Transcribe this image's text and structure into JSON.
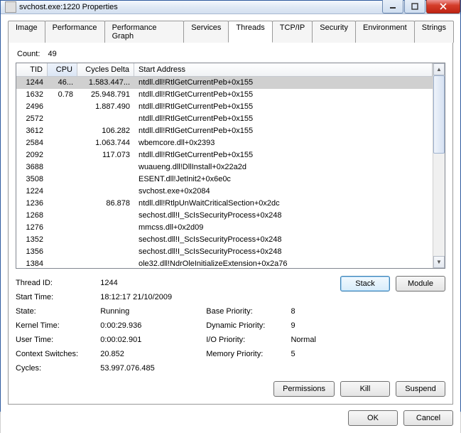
{
  "window": {
    "title": "svchost.exe:1220 Properties"
  },
  "tabs": [
    {
      "label": "Image"
    },
    {
      "label": "Performance"
    },
    {
      "label": "Performance Graph"
    },
    {
      "label": "Services"
    },
    {
      "label": "Threads",
      "active": true
    },
    {
      "label": "TCP/IP"
    },
    {
      "label": "Security"
    },
    {
      "label": "Environment"
    },
    {
      "label": "Strings"
    }
  ],
  "count_label": "Count:",
  "count_value": "49",
  "columns": {
    "tid": "TID",
    "cpu": "CPU",
    "cycles": "Cycles Delta",
    "addr": "Start Address"
  },
  "rows": [
    {
      "tid": "1244",
      "cpu": "46...",
      "cyc": "1.583.447...",
      "addr": "ntdll.dll!RtlGetCurrentPeb+0x155",
      "sel": true
    },
    {
      "tid": "1632",
      "cpu": "0.78",
      "cyc": "25.948.791",
      "addr": "ntdll.dll!RtlGetCurrentPeb+0x155"
    },
    {
      "tid": "2496",
      "cpu": "",
      "cyc": "1.887.490",
      "addr": "ntdll.dll!RtlGetCurrentPeb+0x155"
    },
    {
      "tid": "2572",
      "cpu": "",
      "cyc": "",
      "addr": "ntdll.dll!RtlGetCurrentPeb+0x155"
    },
    {
      "tid": "3612",
      "cpu": "",
      "cyc": "106.282",
      "addr": "ntdll.dll!RtlGetCurrentPeb+0x155"
    },
    {
      "tid": "2584",
      "cpu": "",
      "cyc": "1.063.744",
      "addr": "wbemcore.dll+0x2393"
    },
    {
      "tid": "2092",
      "cpu": "",
      "cyc": "117.073",
      "addr": "ntdll.dll!RtlGetCurrentPeb+0x155"
    },
    {
      "tid": "3688",
      "cpu": "",
      "cyc": "",
      "addr": "wuaueng.dll!DllInstall+0x22a2d"
    },
    {
      "tid": "3508",
      "cpu": "",
      "cyc": "",
      "addr": "ESENT.dll!JetInit2+0x6e0c"
    },
    {
      "tid": "1224",
      "cpu": "",
      "cyc": "",
      "addr": "svchost.exe+0x2084"
    },
    {
      "tid": "1236",
      "cpu": "",
      "cyc": "86.878",
      "addr": "ntdll.dll!RtlpUnWaitCriticalSection+0x2dc"
    },
    {
      "tid": "1268",
      "cpu": "",
      "cyc": "",
      "addr": "sechost.dll!I_ScIsSecurityProcess+0x248"
    },
    {
      "tid": "1276",
      "cpu": "",
      "cyc": "",
      "addr": "mmcss.dll+0x2d09"
    },
    {
      "tid": "1352",
      "cpu": "",
      "cyc": "",
      "addr": "sechost.dll!I_ScIsSecurityProcess+0x248"
    },
    {
      "tid": "1356",
      "cpu": "",
      "cyc": "",
      "addr": "sechost.dll!I_ScIsSecurityProcess+0x248"
    },
    {
      "tid": "1384",
      "cpu": "",
      "cyc": "",
      "addr": "ole32.dll!NdrOleInitializeExtension+0x2a76"
    }
  ],
  "details": {
    "thread_id_label": "Thread ID:",
    "thread_id": "1244",
    "start_time_label": "Start Time:",
    "start_time": "18:12:17   21/10/2009",
    "state_label": "State:",
    "state": "Running",
    "kernel_time_label": "Kernel Time:",
    "kernel_time": "0:00:29.936",
    "user_time_label": "User Time:",
    "user_time": "0:00:02.901",
    "context_switches_label": "Context Switches:",
    "context_switches": "20.852",
    "cycles_label": "Cycles:",
    "cycles": "53.997.076.485",
    "base_priority_label": "Base Priority:",
    "base_priority": "8",
    "dynamic_priority_label": "Dynamic Priority:",
    "dynamic_priority": "9",
    "io_priority_label": "I/O Priority:",
    "io_priority": "Normal",
    "memory_priority_label": "Memory Priority:",
    "memory_priority": "5"
  },
  "buttons": {
    "stack": "Stack",
    "module": "Module",
    "permissions": "Permissions",
    "kill": "Kill",
    "suspend": "Suspend",
    "ok": "OK",
    "cancel": "Cancel"
  }
}
